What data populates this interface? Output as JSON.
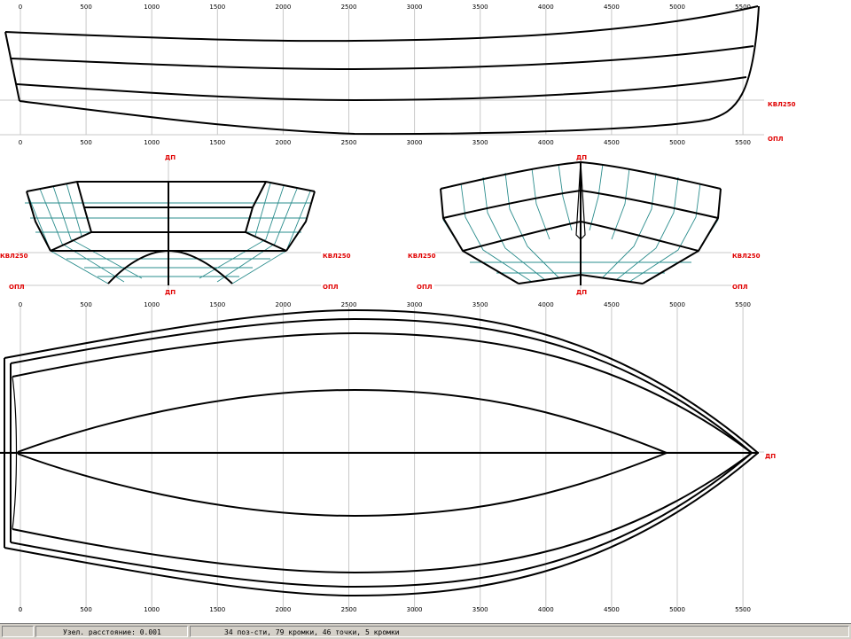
{
  "scale": {
    "ticks": [
      "0",
      "500",
      "1000",
      "1500",
      "2000",
      "2500",
      "3000",
      "3500",
      "4000",
      "4500",
      "5000",
      "5500"
    ]
  },
  "profile": {
    "label_kvl": "КВЛ250",
    "label_opl": "ОПЛ"
  },
  "stern_section": {
    "label_dp_top": "ДП",
    "label_dp_bottom": "ДП",
    "label_kvl_left": "КВЛ250",
    "label_kvl_right": "КВЛ250",
    "label_opl_left": "ОПЛ",
    "label_opl_right": "ОПЛ"
  },
  "bow_section": {
    "label_dp_top": "ДП",
    "label_dp_bottom": "ДП",
    "label_kvl_left": "КВЛ250",
    "label_kvl_right": "КВЛ250",
    "label_opl_left": "ОПЛ",
    "label_opl_right": "ОПЛ"
  },
  "plan": {
    "label_dp": "ДП"
  },
  "status_bar": {
    "distance_text": "Узел. расстояние: 0.001",
    "stats_text": "34 поз-сти, 79 кромки, 46 точки, 5 кромки"
  },
  "colors": {
    "label_red": "#e00000",
    "station_cyan": "#2a8c8c",
    "grid_gray": "#c8c8c8",
    "statusbar_gray": "#d4d0c8"
  }
}
